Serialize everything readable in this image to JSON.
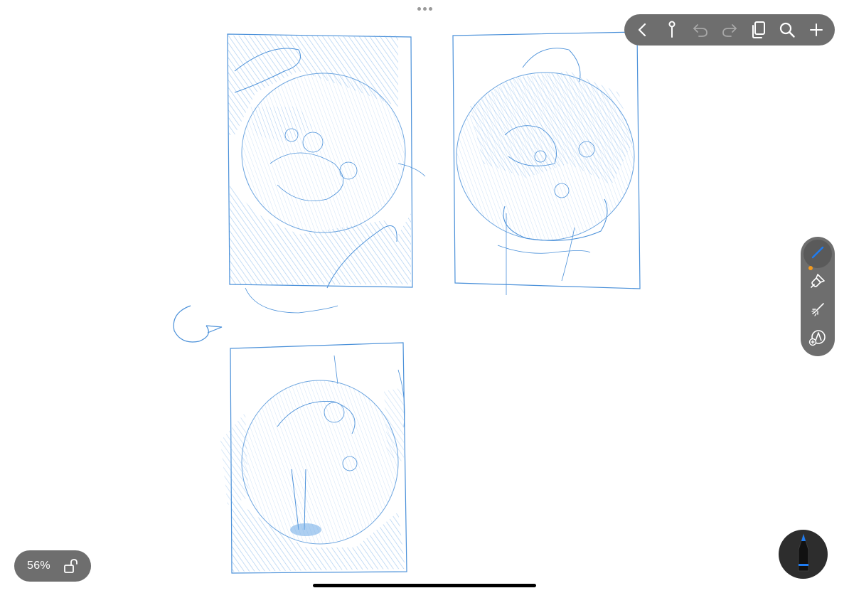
{
  "zoom": {
    "label": "56%"
  },
  "colors": {
    "sketch_stroke": "#4a90d9",
    "sketch_fill": "#8fbdf0",
    "toolbar_bg": "#6e6e6e",
    "active_tool": "#1e7cf2",
    "color_indicator": "#f39a1e",
    "pencil_button_bg": "#2d2d2d"
  },
  "toolbar": {
    "icons": [
      "back-icon",
      "pin-icon",
      "undo-icon",
      "redo-icon",
      "pages-icon",
      "search-icon",
      "add-icon"
    ]
  },
  "tools": {
    "icons": [
      "pencil-icon",
      "paintbrush-icon",
      "sparkle-brush-icon",
      "add-brush-icon"
    ]
  }
}
